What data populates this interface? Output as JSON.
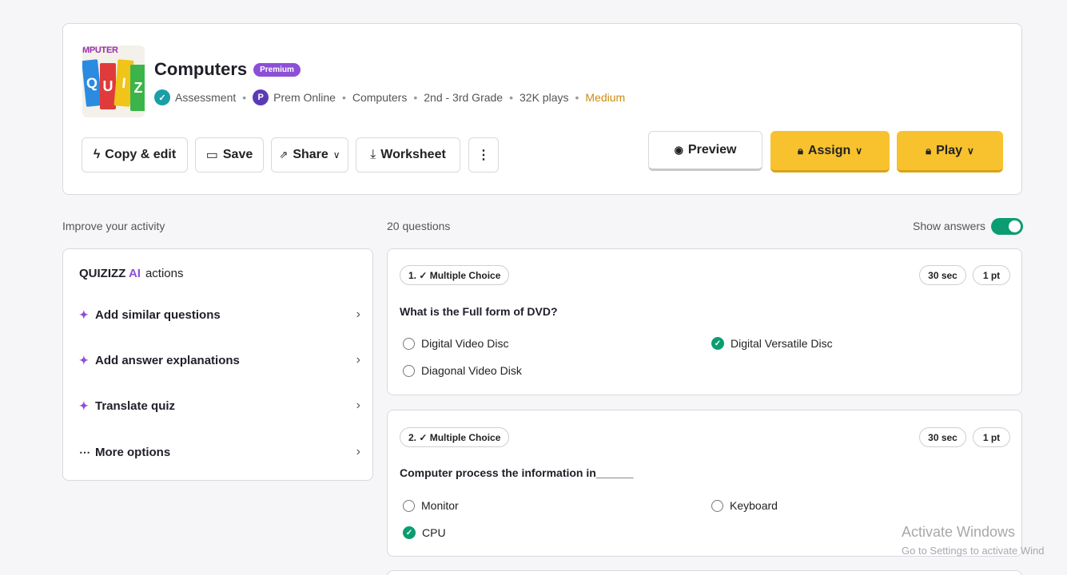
{
  "quiz": {
    "title": "Computers",
    "badge": "Premium",
    "thumbnail_text": "MPUTER",
    "meta": {
      "type": "Assessment",
      "author_initial": "P",
      "author": "Prem Online",
      "subject": "Computers",
      "grade": "2nd - 3rd Grade",
      "plays": "32K plays",
      "difficulty": "Medium"
    }
  },
  "toolbar": {
    "copy_edit": "Copy & edit",
    "save": "Save",
    "share": "Share",
    "worksheet": "Worksheet",
    "more": "⋮",
    "preview": "Preview",
    "assign": "Assign",
    "play": "Play"
  },
  "sidebar": {
    "label": "Improve your activity",
    "brand": "QUIZIZZ",
    "brand_ai": "AI",
    "brand_suffix": "actions",
    "items": [
      {
        "label": "Add similar questions",
        "icon": "sparkle-icon"
      },
      {
        "label": "Add answer explanations",
        "icon": "sparkle-icon"
      },
      {
        "label": "Translate quiz",
        "icon": "sparkle-icon"
      },
      {
        "label": "More options",
        "icon": "ellipsis-icon"
      }
    ]
  },
  "questions_header": {
    "count": "20 questions",
    "show_answers": "Show answers",
    "show_answers_on": true
  },
  "questions": [
    {
      "type_label": "1. ✓ Multiple Choice",
      "time": "30 sec",
      "points": "1 pt",
      "text": "What is the Full form of DVD?",
      "options": [
        {
          "label": "Digital Video Disc",
          "correct": false
        },
        {
          "label": "Digital Versatile Disc",
          "correct": true
        },
        {
          "label": "Diagonal Video Disk",
          "correct": false
        }
      ]
    },
    {
      "type_label": "2. ✓ Multiple Choice",
      "time": "30 sec",
      "points": "1 pt",
      "text": "Computer process the information in______",
      "options": [
        {
          "label": "Monitor",
          "correct": false
        },
        {
          "label": "Keyboard",
          "correct": false
        },
        {
          "label": "CPU",
          "correct": true
        }
      ]
    }
  ],
  "watermark": {
    "line1": "Activate Windows",
    "line2": "Go to Settings to activate Wind"
  },
  "colors": {
    "accent_purple": "#8d4fd6",
    "accent_yellow": "#f7c22e",
    "correct_green": "#0b9d71",
    "difficulty_orange": "#d08a0e"
  }
}
